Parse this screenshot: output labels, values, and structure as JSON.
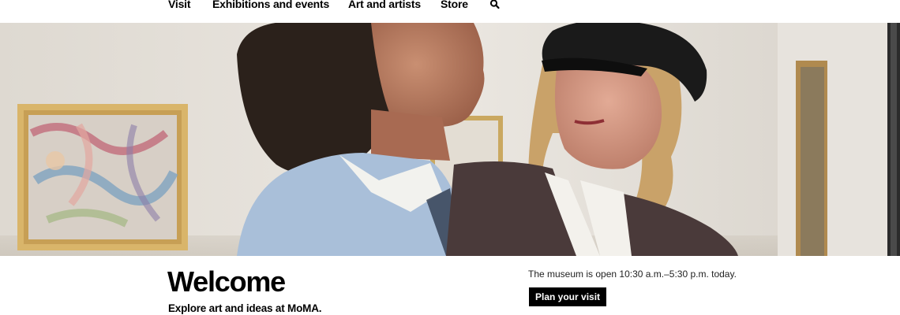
{
  "nav": {
    "items": [
      "Visit",
      "Exhibitions and events",
      "Art and artists",
      "Store"
    ],
    "search_icon": "search-icon"
  },
  "hero": {
    "image": "hero-photo",
    "colors": {
      "wall": "#e6e2dc",
      "frame": "#d9b56a",
      "shirt": "#a9bfd9",
      "cardigan": "#4a3a3a",
      "hair_dark": "#2b211b",
      "hair_blonde": "#c9a269",
      "cap": "#1a1a1a"
    }
  },
  "welcome": {
    "title": "Welcome",
    "subtitle": "Explore art and ideas at MoMA.",
    "hours": "The museum is open 10:30 a.m.–5:30 p.m. today.",
    "cta_label": "Plan your visit"
  },
  "colors": {
    "text": "#000000",
    "button_bg": "#000000",
    "button_text": "#ffffff",
    "background": "#ffffff"
  }
}
